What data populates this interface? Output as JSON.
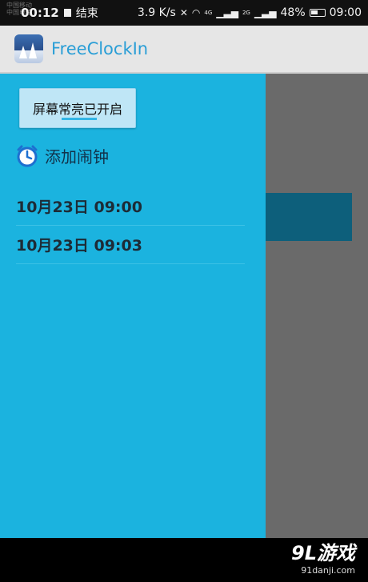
{
  "status_bar": {
    "carrier_top": "中国移动",
    "carrier_bottom": "中国电信",
    "time": "00:12",
    "notification": "结束",
    "net_speed": "3.9 K/s",
    "signal_4g": "4G",
    "signal_2g": "2G",
    "battery": "48%",
    "clock": "09:00"
  },
  "app_bar": {
    "title": "FreeClockIn",
    "icon": "snow-tree-app-icon"
  },
  "drawer": {
    "screen_button_label": "屏幕常亮已开启",
    "add_alarm_label": "添加闹钟",
    "alarms": [
      {
        "time": "10月23日  09:00"
      },
      {
        "time": "10月23日  09:03"
      }
    ]
  },
  "watermark": {
    "logo": "9L游戏",
    "site": "91danji.com"
  },
  "colors": {
    "drawer_bg": "#1bb3df",
    "title_color": "#2a9ed6",
    "dark_bar": "#0d5f7b",
    "overlay": "#6a6a6a"
  }
}
